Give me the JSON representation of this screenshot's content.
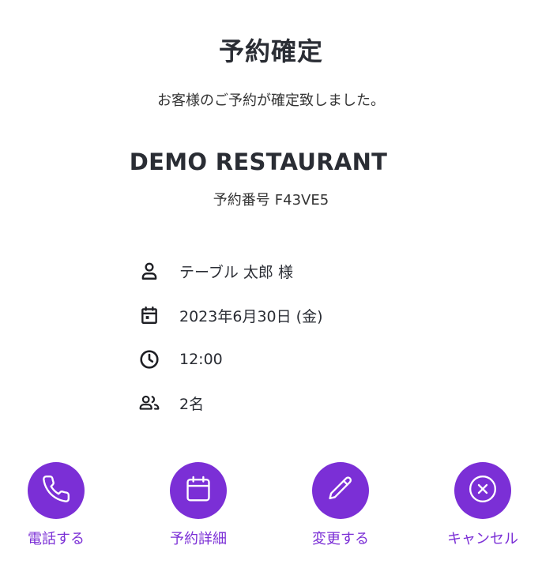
{
  "title": "予約確定",
  "subtitle": "お客様のご予約が確定致しました。",
  "restaurant_name": "DEMO RESTAURANT",
  "reservation": {
    "label": "予約番号",
    "number": "F43VE5"
  },
  "details": {
    "guest": {
      "icon": "user-icon",
      "text": "テーブル 太郎 様"
    },
    "date": {
      "icon": "calendar-icon",
      "text": "2023年6月30日 (金)"
    },
    "time": {
      "icon": "clock-icon",
      "text": "12:00"
    },
    "party": {
      "icon": "people-icon",
      "text": "2名"
    }
  },
  "actions": {
    "call": {
      "icon": "phone-icon",
      "label": "電話する"
    },
    "details": {
      "icon": "calendar-icon",
      "label": "予約詳細"
    },
    "edit": {
      "icon": "pencil-icon",
      "label": "変更する"
    },
    "cancel": {
      "icon": "close-circle-icon",
      "label": "キャンセル"
    }
  },
  "colors": {
    "accent": "#7b2fd6",
    "text": "#2a2d34",
    "background": "#ffffff"
  }
}
